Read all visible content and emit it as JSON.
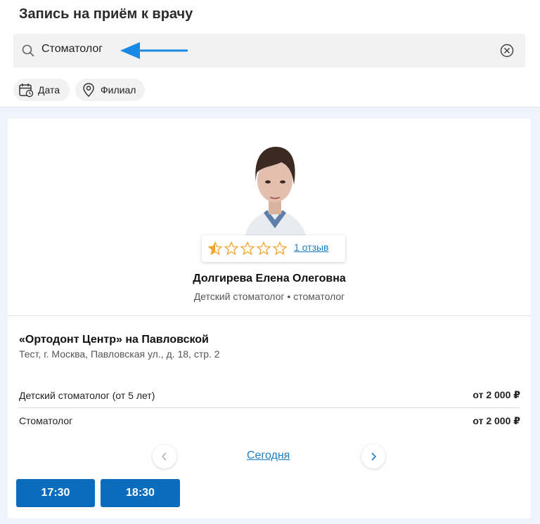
{
  "header": {
    "title": "Запись на приём к врачу"
  },
  "search": {
    "value": "Стоматолог",
    "icon": "search-icon",
    "clear_icon": "clear-icon",
    "annotation_color": "#1a8ae6"
  },
  "filters": [
    {
      "label": "Дата",
      "icon": "calendar-icon"
    },
    {
      "label": "Филиал",
      "icon": "location-pin-icon"
    }
  ],
  "doctor": {
    "name": "Долгирева Елена Олеговна",
    "specialty": "Детский стоматолог • стоматолог",
    "rating": 0.5,
    "rating_max": 5,
    "reviews_label": "1 отзыв",
    "star_color": "#f0a530"
  },
  "clinic": {
    "name": "«Ортодонт Центр» на Павловской",
    "address": "Тест, г. Москва, Павловская ул., д. 18, стр. 2"
  },
  "services": [
    {
      "name": "Детский стоматолог (от 5 лет)",
      "price": "от 2 000 ₽"
    },
    {
      "name": "Стоматолог",
      "price": "от 2 000 ₽"
    }
  ],
  "schedule": {
    "day_label": "Сегодня",
    "slots": [
      "17:30",
      "18:30"
    ],
    "accent": "#0b6bbd"
  }
}
